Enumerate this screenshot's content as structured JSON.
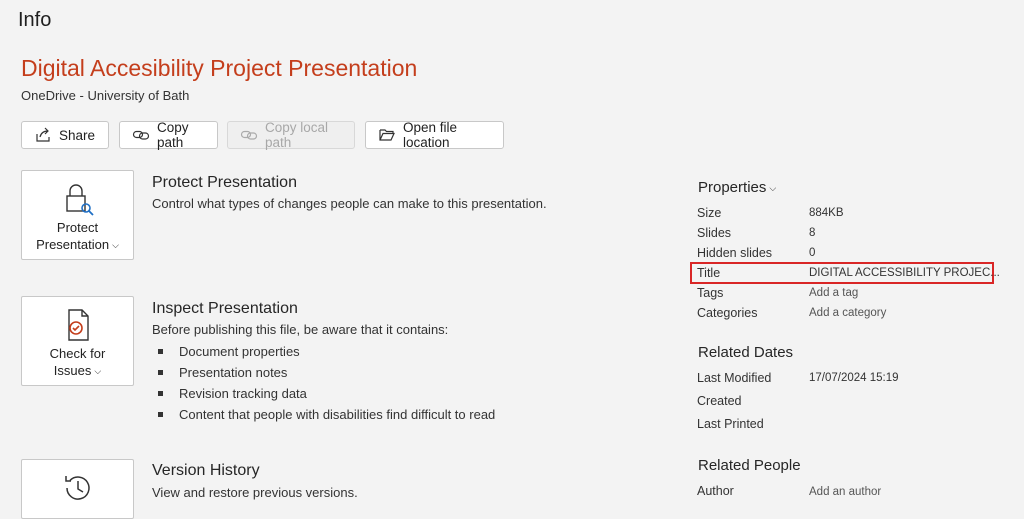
{
  "header": {
    "info": "Info"
  },
  "document": {
    "title": "Digital Accesibility Project Presentation",
    "location": "OneDrive - University of Bath"
  },
  "toolbar": {
    "share": "Share",
    "copy_path": "Copy path",
    "copy_local_path": "Copy local path",
    "open_file_location": "Open file location"
  },
  "protect": {
    "button_line1": "Protect",
    "button_line2": "Presentation",
    "heading": "Protect Presentation",
    "description": "Control what types of changes people can make to this presentation."
  },
  "inspect": {
    "button_line1": "Check for",
    "button_line2": "Issues",
    "heading": "Inspect Presentation",
    "description": "Before publishing this file, be aware that it contains:",
    "items": [
      "Document properties",
      "Presentation notes",
      "Revision tracking data",
      "Content that people with disabilities find difficult to read"
    ]
  },
  "version": {
    "heading": "Version History",
    "description": "View and restore previous versions."
  },
  "properties": {
    "heading": "Properties",
    "rows": [
      {
        "label": "Size",
        "value": "884KB"
      },
      {
        "label": "Slides",
        "value": "8"
      },
      {
        "label": "Hidden slides",
        "value": "0"
      },
      {
        "label": "Title",
        "value": "DIGITAL  ACCESSIBILITY PROJEC..."
      },
      {
        "label": "Tags",
        "value": "Add a tag"
      },
      {
        "label": "Categories",
        "value": "Add a category"
      }
    ]
  },
  "related_dates": {
    "heading": "Related Dates",
    "rows": [
      {
        "label": "Last Modified",
        "value": "17/07/2024 15:19"
      },
      {
        "label": "Created",
        "value": ""
      },
      {
        "label": "Last Printed",
        "value": ""
      }
    ]
  },
  "related_people": {
    "heading": "Related People",
    "rows": [
      {
        "label": "Author",
        "value": "Add an author"
      }
    ]
  },
  "colors": {
    "title_accent": "#c43e1c",
    "highlight": "#d92626"
  }
}
